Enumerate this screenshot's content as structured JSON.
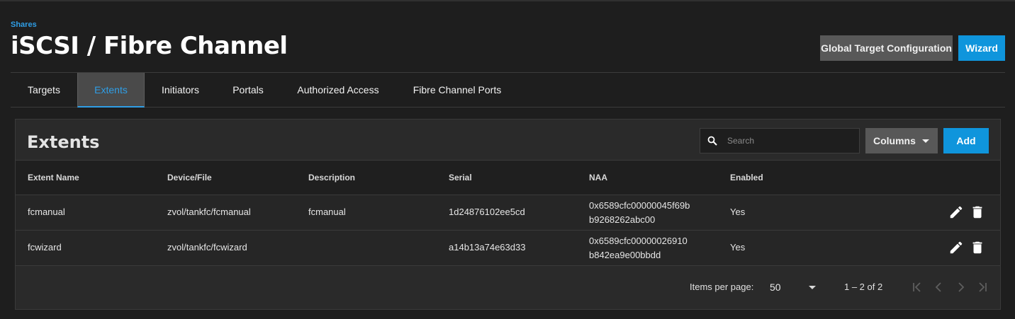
{
  "breadcrumb": "Shares",
  "page_title": "iSCSI / Fibre Channel",
  "header_buttons": {
    "global_target_configuration": "Global Target Configuration",
    "wizard": "Wizard"
  },
  "tabs": [
    {
      "label": "Targets",
      "active": false
    },
    {
      "label": "Extents",
      "active": true
    },
    {
      "label": "Initiators",
      "active": false
    },
    {
      "label": "Portals",
      "active": false
    },
    {
      "label": "Authorized Access",
      "active": false
    },
    {
      "label": "Fibre Channel Ports",
      "active": false
    }
  ],
  "card": {
    "title": "Extents",
    "search": {
      "placeholder": "Search",
      "value": ""
    },
    "columns_label": "Columns",
    "add_label": "Add"
  },
  "table": {
    "headers": [
      "Extent Name",
      "Device/File",
      "Description",
      "Serial",
      "NAA",
      "Enabled"
    ],
    "rows": [
      {
        "extent_name": "fcmanual",
        "device_file": "zvol/tankfc/fcmanual",
        "description": "fcmanual",
        "serial": "1d24876102ee5cd",
        "naa_line1": "0x6589cfc00000045f69b",
        "naa_line2": "b9268262abc00",
        "enabled": "Yes"
      },
      {
        "extent_name": "fcwizard",
        "device_file": "zvol/tankfc/fcwizard",
        "description": "",
        "serial": "a14b13a74e63d33",
        "naa_line1": "0x6589cfc00000026910",
        "naa_line2": "b842ea9e00bbdd",
        "enabled": "Yes"
      }
    ],
    "row_action_icons": [
      "edit-icon",
      "delete-icon"
    ]
  },
  "paginator": {
    "items_per_page_label": "Items per page:",
    "page_size": "50",
    "range_label": "1 – 2 of 2"
  },
  "colors": {
    "accent": "#0f95dc",
    "link": "#2f9ee6",
    "background": "#1e1e1e",
    "card": "#2a2a2a"
  }
}
